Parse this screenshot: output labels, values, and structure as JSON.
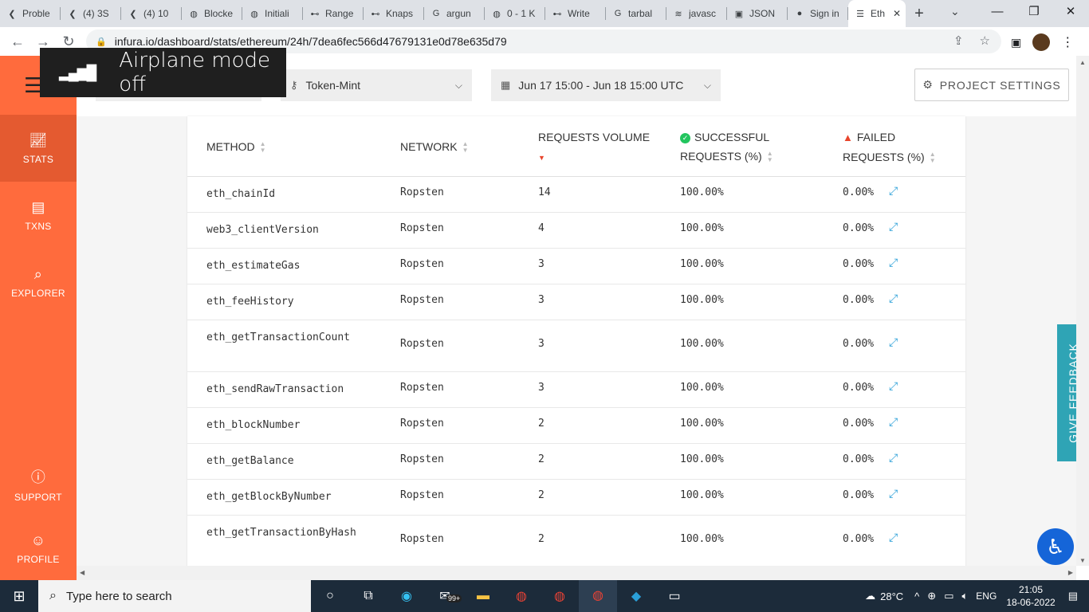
{
  "browser": {
    "tabs": [
      {
        "label": "Proble",
        "icon": "k"
      },
      {
        "label": "(4) 3S",
        "icon": "k"
      },
      {
        "label": "(4) 10",
        "icon": "k"
      },
      {
        "label": "Blocke",
        "icon": "globe"
      },
      {
        "label": "Initiali",
        "icon": "globe"
      },
      {
        "label": "Range",
        "icon": "gg"
      },
      {
        "label": "Knaps",
        "icon": "gg"
      },
      {
        "label": "argun",
        "icon": "G"
      },
      {
        "label": "0 - 1 K",
        "icon": "globe"
      },
      {
        "label": "Write",
        "icon": "gg"
      },
      {
        "label": "tarbal",
        "icon": "G"
      },
      {
        "label": "javasc",
        "icon": "so"
      },
      {
        "label": "JSON",
        "icon": "box"
      },
      {
        "label": "Sign in",
        "icon": "github"
      },
      {
        "label": "Eth",
        "icon": "infura",
        "active": true
      }
    ],
    "url": "infura.io/dashboard/stats/ethereum/24h/7dea6fec566d47679131e0d78e635d79"
  },
  "toast": {
    "message": "Airplane mode off"
  },
  "sidebar": {
    "items": [
      {
        "label": "STATS",
        "icon": "chart-icon"
      },
      {
        "label": "TXNS",
        "icon": "receipt-icon"
      },
      {
        "label": "EXPLORER",
        "icon": "explorer-icon"
      },
      {
        "label": "SUPPORT",
        "icon": "help-icon"
      },
      {
        "label": "PROFILE",
        "icon": "profile-icon"
      }
    ]
  },
  "filters": {
    "project": "Token-Mint",
    "date_range": "Jun 17 15:00 - Jun 18 15:00 UTC",
    "settings_label": "PROJECT SETTINGS"
  },
  "table": {
    "headers": {
      "method": "METHOD",
      "network": "NETWORK",
      "volume": "REQUESTS VOLUME",
      "successful_1": "SUCCESSFUL",
      "successful_2": "REQUESTS (%)",
      "failed_1": "FAILED",
      "failed_2": "REQUESTS (%)"
    },
    "rows": [
      {
        "method": "eth_chainId",
        "network": "Ropsten",
        "volume": "14",
        "success": "100.00%",
        "failed": "0.00%"
      },
      {
        "method": "web3_clientVersion",
        "network": "Ropsten",
        "volume": "4",
        "success": "100.00%",
        "failed": "0.00%"
      },
      {
        "method": "eth_estimateGas",
        "network": "Ropsten",
        "volume": "3",
        "success": "100.00%",
        "failed": "0.00%"
      },
      {
        "method": "eth_feeHistory",
        "network": "Ropsten",
        "volume": "3",
        "success": "100.00%",
        "failed": "0.00%"
      },
      {
        "method": "eth_getTransactionCount",
        "network": "Ropsten",
        "volume": "3",
        "success": "100.00%",
        "failed": "0.00%"
      },
      {
        "method": "eth_sendRawTransaction",
        "network": "Ropsten",
        "volume": "3",
        "success": "100.00%",
        "failed": "0.00%"
      },
      {
        "method": "eth_blockNumber",
        "network": "Ropsten",
        "volume": "2",
        "success": "100.00%",
        "failed": "0.00%"
      },
      {
        "method": "eth_getBalance",
        "network": "Ropsten",
        "volume": "2",
        "success": "100.00%",
        "failed": "0.00%"
      },
      {
        "method": "eth_getBlockByNumber",
        "network": "Ropsten",
        "volume": "2",
        "success": "100.00%",
        "failed": "0.00%"
      },
      {
        "method": "eth_getTransactionByHash",
        "network": "Ropsten",
        "volume": "2",
        "success": "100.00%",
        "failed": "0.00%"
      }
    ]
  },
  "feedback": {
    "label": "GIVE FEEDBACK"
  },
  "taskbar": {
    "search_placeholder": "Type here to search",
    "badge": "99+",
    "temperature": "28°C",
    "language": "ENG",
    "time": "21:05",
    "date": "18-06-2022"
  }
}
